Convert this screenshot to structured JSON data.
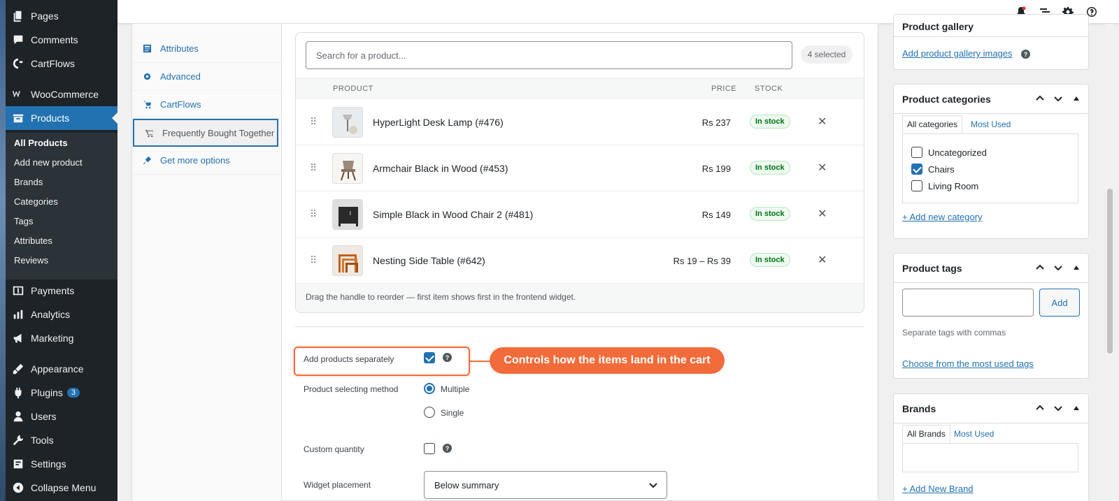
{
  "admin_menu": {
    "items_top": [
      {
        "label": "Pages",
        "icon": "pages-icon"
      },
      {
        "label": "Comments",
        "icon": "comments-icon"
      },
      {
        "label": "CartFlows",
        "icon": "cartflows-icon"
      },
      {
        "label": "WooCommerce",
        "icon": "woocommerce-icon"
      },
      {
        "label": "Products",
        "icon": "products-icon"
      }
    ],
    "products_sub": [
      "All Products",
      "Add new product",
      "Brands",
      "Categories",
      "Tags",
      "Attributes",
      "Reviews"
    ],
    "items_bottom": [
      {
        "label": "Payments",
        "icon": "payments-icon"
      },
      {
        "label": "Analytics",
        "icon": "analytics-icon"
      },
      {
        "label": "Marketing",
        "icon": "marketing-icon"
      },
      {
        "label": "Appearance",
        "icon": "appearance-icon"
      },
      {
        "label": "Plugins",
        "icon": "plugins-icon",
        "badge": "3"
      },
      {
        "label": "Users",
        "icon": "users-icon"
      },
      {
        "label": "Tools",
        "icon": "tools-icon"
      },
      {
        "label": "Settings",
        "icon": "settings-icon"
      },
      {
        "label": "Collapse Menu",
        "icon": "collapse-icon"
      }
    ]
  },
  "product_tabs": [
    {
      "label": "Attributes",
      "icon": "attributes-icon"
    },
    {
      "label": "Advanced",
      "icon": "advanced-gear-icon"
    },
    {
      "label": "CartFlows",
      "icon": "cartflows-icon"
    },
    {
      "label": "Frequently Bought Together",
      "icon": "cart-icon",
      "active": true
    },
    {
      "label": "Get more options",
      "icon": "plugin-icon"
    }
  ],
  "fbt": {
    "search_placeholder": "Search for a product...",
    "selected_count": "4 selected",
    "columns": {
      "product": "PRODUCT",
      "price": "PRICE",
      "stock": "STOCK"
    },
    "rows": [
      {
        "name": "HyperLight Desk Lamp (#476)",
        "price": "Rs 237",
        "stock": "In stock"
      },
      {
        "name": "Armchair Black in Wood (#453)",
        "price": "Rs 199",
        "stock": "In stock"
      },
      {
        "name": "Simple Black in Wood Chair 2 (#481)",
        "price": "Rs 149",
        "stock": "In stock"
      },
      {
        "name": "Nesting Side Table (#642)",
        "price": "Rs 19 – Rs 39",
        "stock": "In stock"
      }
    ],
    "hint": "Drag the handle to reorder — first item shows first in the frontend widget.",
    "settings": {
      "add_separately_label": "Add products separately",
      "add_separately_checked": true,
      "selecting_method_label": "Product selecting method",
      "method_options": [
        "Multiple",
        "Single"
      ],
      "method_selected": "Multiple",
      "custom_quantity_label": "Custom quantity",
      "custom_quantity_checked": false,
      "placement_label": "Widget placement",
      "placement_value": "Below summary"
    },
    "callout": "Controls how the items land in the cart"
  },
  "gallery": {
    "title": "Product gallery",
    "link": "Add product gallery images"
  },
  "categories": {
    "title": "Product categories",
    "tab_all": "All categories",
    "tab_most": "Most Used",
    "items": [
      {
        "label": "Uncategorized",
        "checked": false
      },
      {
        "label": "Chairs",
        "checked": true
      },
      {
        "label": "Living Room",
        "checked": false
      }
    ],
    "add_link": "+ Add new category"
  },
  "tags": {
    "title": "Product tags",
    "add_button": "Add",
    "help": "Separate tags with commas",
    "choose_link": "Choose from the most used tags"
  },
  "brands": {
    "title": "Brands",
    "tab_all": "All Brands",
    "tab_most": "Most Used",
    "add_link": "+ Add New Brand"
  },
  "colors": {
    "accent": "#2271b1",
    "callout": "#f26b3a",
    "menu_bg": "#1d2327"
  }
}
